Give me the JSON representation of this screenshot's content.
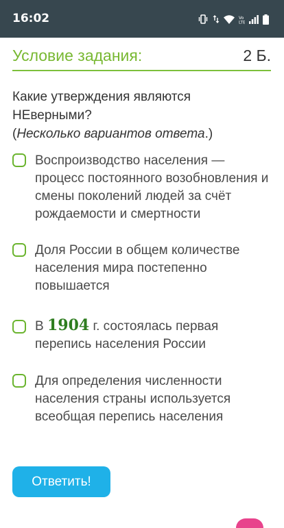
{
  "status_bar": {
    "time": "16:02",
    "icons": [
      "vibrate-icon",
      "data-arrows-icon",
      "wifi-icon",
      "volte-icon",
      "signal-icon",
      "battery-icon"
    ]
  },
  "header": {
    "title": "Условие задания:",
    "points": "2 Б."
  },
  "question": {
    "text": "Какие утверждения являются НЕверными?",
    "hint_open": "(",
    "hint": "Несколько вариантов ответа",
    "hint_close": ".)"
  },
  "options": [
    {
      "text": "Воспроизводство населения — процесс постоянного возобновления и смены поколений людей за счёт рождаемости и смертности"
    },
    {
      "text": "Доля России в общем количестве населения мира постепенно повышается"
    },
    {
      "prefix": "В ",
      "year": "1904",
      "suffix": " г. состоялась первая перепись населения России"
    },
    {
      "text": "Для определения численности населения страны используется всеобщая перепись населения"
    }
  ],
  "answer_button": {
    "label": "Ответить!"
  },
  "colors": {
    "status_bar": "#37474f",
    "accent_green": "#78b832",
    "button_blue": "#1fb1e8",
    "year_green": "#2e7d1f"
  }
}
